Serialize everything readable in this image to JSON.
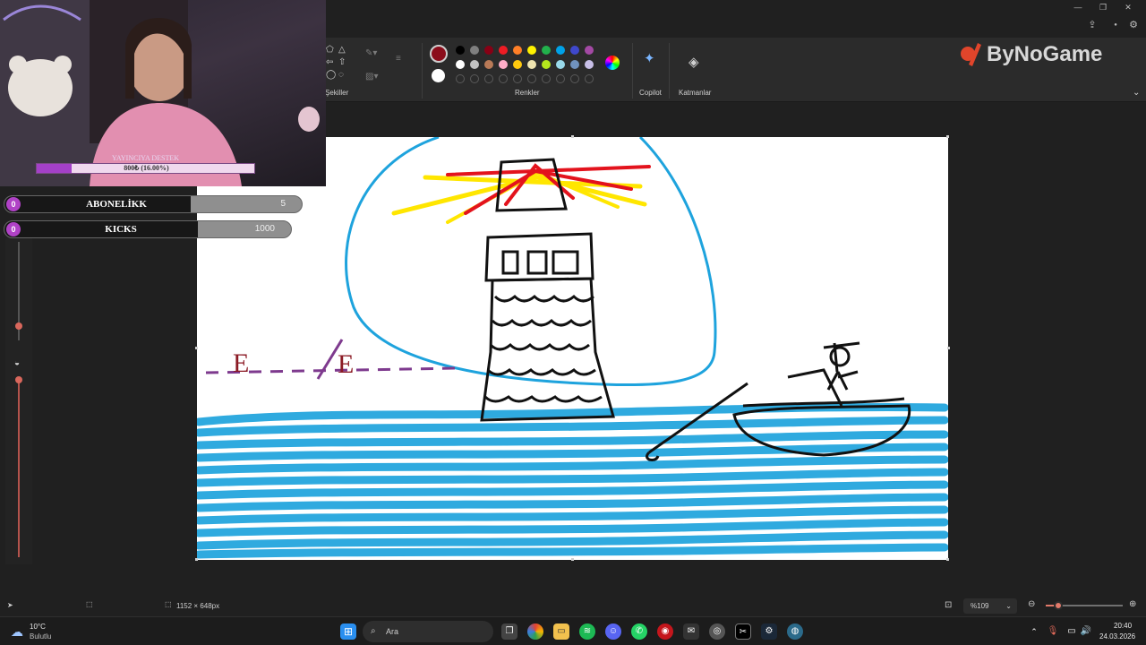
{
  "overlay": {
    "support_title": "YAYINCIYA DESTEK",
    "support_text": "800₺ (16.00%)",
    "support_progress": 0.16,
    "goals": [
      {
        "label": "ABONELİKK",
        "count": "0",
        "target": "5",
        "progress": 0
      },
      {
        "label": "KICKS",
        "count": "0",
        "target": "1000",
        "progress": 0
      }
    ],
    "watermark": "ByNoGame"
  },
  "ribbon": {
    "shapes_label": "Şekiller",
    "colors_label": "Renkler",
    "copilot_label": "Copilot",
    "layers_label": "Katmanlar",
    "primary_color": "#8b0d1b",
    "secondary_color": "#ffffff",
    "palette_row1": [
      "#000000",
      "#7f7f7f",
      "#880015",
      "#ed1c24",
      "#ff7f27",
      "#fff200",
      "#22b14c",
      "#00a2e8",
      "#3f48cc",
      "#a349a4"
    ],
    "palette_row2": [
      "#ffffff",
      "#c3c3c3",
      "#b97a57",
      "#ffaec9",
      "#ffc90e",
      "#efe4b0",
      "#b5e61d",
      "#99d9ea",
      "#7092be",
      "#c8bfe7"
    ]
  },
  "status": {
    "canvas_size": "1152 × 648px",
    "zoom": "%109",
    "zoom_level": 0.16
  },
  "taskbar": {
    "weather_temp": "10°C",
    "weather_desc": "Bulutlu",
    "search_placeholder": "Ara",
    "time": "20:40",
    "date": "24.03.2026"
  },
  "drawing": {
    "letter_left": "E",
    "letter_right": "E"
  }
}
